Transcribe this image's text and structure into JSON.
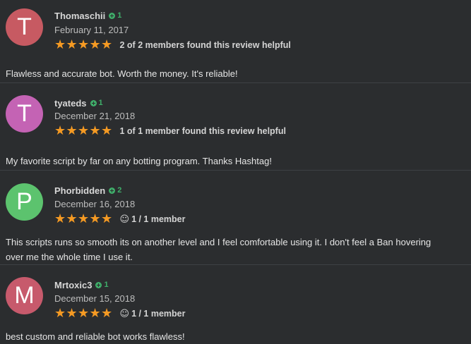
{
  "reviews": [
    {
      "avatar_letter": "T",
      "avatar_color": "#c75a62",
      "username": "Thomaschii",
      "reputation": "1",
      "date": "February 11, 2017",
      "stars": 5,
      "helpful": "2 of 2 members found this review helpful",
      "body": "Flawless and accurate bot. Worth the money. It's reliable!"
    },
    {
      "avatar_letter": "T",
      "avatar_color": "#c463b4",
      "username": "tyateds",
      "reputation": "1",
      "date": "December 21, 2018",
      "stars": 5,
      "helpful": "1 of 1 member found this review helpful",
      "body": "My favorite script by far on any botting program. Thanks Hashtag!"
    },
    {
      "avatar_letter": "P",
      "avatar_color": "#5cc36e",
      "username": "Phorbidden",
      "reputation": "2",
      "date": "December 16, 2018",
      "stars": 5,
      "vote": "1 / 1 member",
      "body_line1": "This scripts runs so smooth its on another level and I feel comfortable using it. I don't feel a Ban hovering",
      "body_line2": "over me the whole time I use it."
    },
    {
      "avatar_letter": "M",
      "avatar_color": "#c75a6c",
      "username": "Mrtoxic3",
      "reputation": "1",
      "date": "December 15, 2018",
      "stars": 5,
      "vote": "1 / 1 member",
      "body": "best custom and reliable bot works flawless!"
    }
  ],
  "icons": {
    "star": "★",
    "smile": "☺",
    "reputation": "plus-circle-icon"
  },
  "colors": {
    "background": "#2b2d2f",
    "star": "#f59a23",
    "reputation": "#3fae6a"
  }
}
